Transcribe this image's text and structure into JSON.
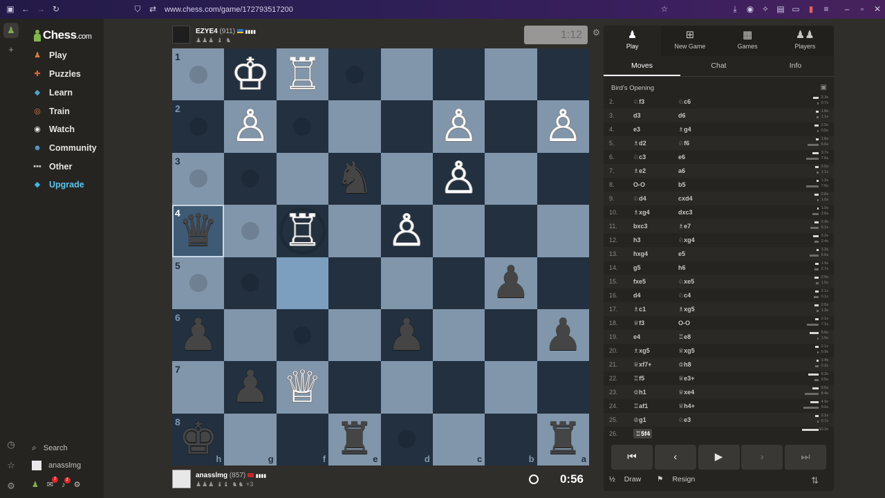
{
  "browser": {
    "url": "www.chess.com/game/172793517200"
  },
  "nav": {
    "logo": "Chess",
    "logo_suffix": ".com",
    "items": [
      {
        "label": "Play",
        "icon": "play-icon",
        "color": "#e07b3a"
      },
      {
        "label": "Puzzles",
        "icon": "puzzle-icon",
        "color": "#e0633a"
      },
      {
        "label": "Learn",
        "icon": "learn-icon",
        "color": "#4ba5c9"
      },
      {
        "label": "Train",
        "icon": "train-icon",
        "color": "#e07b3a"
      },
      {
        "label": "Watch",
        "icon": "watch-icon",
        "color": "#e6e5e3"
      },
      {
        "label": "Community",
        "icon": "community-icon",
        "color": "#5b9fd6"
      },
      {
        "label": "Other",
        "icon": "more-icon",
        "color": "#c3c2c0"
      },
      {
        "label": "Upgrade",
        "icon": "diamond-icon",
        "color": "#3fb9e6"
      }
    ],
    "search_label": "Search",
    "username": "anasslmg",
    "mail_badge": "7",
    "notif_badge": "2"
  },
  "top_player": {
    "name": "EZYE4",
    "rating": "(911)",
    "clock": "1:12"
  },
  "bottom_player": {
    "name": "anasslmg",
    "rating": "(857)",
    "captured_extra": "+3",
    "clock": "0:56"
  },
  "board": {
    "ranks": [
      "1",
      "2",
      "3",
      "4",
      "5",
      "6",
      "7",
      "8"
    ],
    "files": [
      "h",
      "g",
      "f",
      "e",
      "d",
      "c",
      "b",
      "a"
    ],
    "rows": [
      [
        {
          "c": "l",
          "dot": 1
        },
        {
          "c": "d",
          "p": "♔",
          "s": "w"
        },
        {
          "c": "l",
          "p": "♖",
          "s": "w"
        },
        {
          "c": "d",
          "dot": 1
        },
        {
          "c": "l"
        },
        {
          "c": "d"
        },
        {
          "c": "l"
        },
        {
          "c": "d"
        }
      ],
      [
        {
          "c": "d",
          "dot": 1
        },
        {
          "c": "l",
          "p": "♙",
          "s": "w"
        },
        {
          "c": "d",
          "dot": 1
        },
        {
          "c": "l"
        },
        {
          "c": "d"
        },
        {
          "c": "l",
          "p": "♙",
          "s": "w"
        },
        {
          "c": "d"
        },
        {
          "c": "l",
          "p": "♙",
          "s": "w"
        }
      ],
      [
        {
          "c": "l",
          "dot": 1
        },
        {
          "c": "d",
          "dot": 1
        },
        {
          "c": "l"
        },
        {
          "c": "d",
          "p": "♞",
          "s": "b"
        },
        {
          "c": "l"
        },
        {
          "c": "d",
          "p": "♙",
          "s": "w"
        },
        {
          "c": "l"
        },
        {
          "c": "d"
        }
      ],
      [
        {
          "c": "sel",
          "p": "♛",
          "s": "b"
        },
        {
          "c": "l",
          "dot": 1
        },
        {
          "c": "d",
          "p": "♖",
          "s": "w",
          "ring": 1
        },
        {
          "c": "l"
        },
        {
          "c": "d",
          "p": "♙",
          "s": "w"
        },
        {
          "c": "l"
        },
        {
          "c": "d"
        },
        {
          "c": "l"
        }
      ],
      [
        {
          "c": "l",
          "dot": 1
        },
        {
          "c": "d",
          "dot": 1
        },
        {
          "c": "hl"
        },
        {
          "c": "d"
        },
        {
          "c": "l"
        },
        {
          "c": "d"
        },
        {
          "c": "l",
          "p": "♟",
          "s": "b"
        },
        {
          "c": "d"
        }
      ],
      [
        {
          "c": "d",
          "p": "♟",
          "s": "b"
        },
        {
          "c": "l"
        },
        {
          "c": "d",
          "dot": 1
        },
        {
          "c": "l"
        },
        {
          "c": "d",
          "p": "♟",
          "s": "b"
        },
        {
          "c": "l"
        },
        {
          "c": "d"
        },
        {
          "c": "l",
          "p": "♟",
          "s": "b"
        }
      ],
      [
        {
          "c": "l"
        },
        {
          "c": "d",
          "p": "♟",
          "s": "b"
        },
        {
          "c": "l",
          "p": "♕",
          "s": "w"
        },
        {
          "c": "d"
        },
        {
          "c": "l"
        },
        {
          "c": "d"
        },
        {
          "c": "l"
        },
        {
          "c": "d"
        }
      ],
      [
        {
          "c": "d",
          "p": "♚",
          "s": "b"
        },
        {
          "c": "l"
        },
        {
          "c": "d"
        },
        {
          "c": "l",
          "p": "♜",
          "s": "b"
        },
        {
          "c": "d",
          "dot": 1
        },
        {
          "c": "l"
        },
        {
          "c": "d"
        },
        {
          "c": "l",
          "p": "♜",
          "s": "b"
        }
      ]
    ]
  },
  "panel": {
    "tabs": [
      {
        "label": "Play",
        "icon": "pawn-play-icon"
      },
      {
        "label": "New Game",
        "icon": "plus-icon"
      },
      {
        "label": "Games",
        "icon": "board-icon"
      },
      {
        "label": "Players",
        "icon": "players-icon"
      }
    ],
    "subtabs": [
      "Moves",
      "Chat",
      "Info"
    ],
    "opening": "Bird's Opening",
    "moves": [
      {
        "n": "2.",
        "w": "♘f3",
        "b": "♘c6",
        "wt": "3.3s",
        "bt": "0.7s",
        "wf": 0.32,
        "bf": 0.07
      },
      {
        "n": "3.",
        "w": "d3",
        "b": "d6",
        "wt": "1.8s",
        "bt": "1.1s",
        "wf": 0.18,
        "bf": 0.11
      },
      {
        "n": "4.",
        "w": "e3",
        "b": "♗g4",
        "wt": "2.5s",
        "bt": "0.5s",
        "wf": 0.25,
        "bf": 0.05
      },
      {
        "n": "5.",
        "w": "♗d2",
        "b": "♘f6",
        "wt": "1.6s",
        "bt": "6.6s",
        "wf": 0.16,
        "bf": 0.66
      },
      {
        "n": "6.",
        "w": "♘c3",
        "b": "e6",
        "wt": "3.7s",
        "bt": "7.6s",
        "wf": 0.37,
        "bf": 0.76
      },
      {
        "n": "7.",
        "w": "♗e2",
        "b": "a6",
        "wt": "2.0s",
        "bt": "1.1s",
        "wf": 0.2,
        "bf": 0.11
      },
      {
        "n": "8.",
        "w": "O-O",
        "b": "b5",
        "wt": "1.2s",
        "bt": "7.6s",
        "wf": 0.12,
        "bf": 0.76
      },
      {
        "n": "9.",
        "w": "♘d4",
        "b": "cxd4",
        "wt": "2.6s",
        "bt": "1.0s",
        "wf": 0.26,
        "bf": 0.1
      },
      {
        "n": "10.",
        "w": "♗xg4",
        "b": "dxc3",
        "wt": "1.0s",
        "bt": "3.6s",
        "wf": 0.1,
        "bf": 0.36
      },
      {
        "n": "11.",
        "w": "bxc3",
        "b": "♗e7",
        "wt": "2.4s",
        "bt": "5.1s",
        "wf": 0.24,
        "bf": 0.51
      },
      {
        "n": "12.",
        "w": "h3",
        "b": "♘xg4",
        "wt": "3.2s",
        "bt": "2.4s",
        "wf": 0.32,
        "bf": 0.24
      },
      {
        "n": "13.",
        "w": "hxg4",
        "b": "e5",
        "wt": "1.2s",
        "bt": "5.6s",
        "wf": 0.12,
        "bf": 0.56
      },
      {
        "n": "14.",
        "w": "g5",
        "b": "h6",
        "wt": "1.9s",
        "bt": "2.7s",
        "wf": 0.19,
        "bf": 0.27
      },
      {
        "n": "15.",
        "w": "fxe5",
        "b": "♘xe5",
        "wt": "2.5s",
        "bt": "1.5s",
        "wf": 0.25,
        "bf": 0.15
      },
      {
        "n": "16.",
        "w": "d4",
        "b": "♘c4",
        "wt": "2.1s",
        "bt": "3.1s",
        "wf": 0.21,
        "bf": 0.31
      },
      {
        "n": "17.",
        "w": "♗c1",
        "b": "♗xg5",
        "wt": "2.5s",
        "bt": "1.3s",
        "wf": 0.25,
        "bf": 0.13
      },
      {
        "n": "18.",
        "w": "♕f3",
        "b": "O-O",
        "wt": "2.1s",
        "bt": "7.1s",
        "wf": 0.21,
        "bf": 0.71
      },
      {
        "n": "19.",
        "w": "e4",
        "b": "♖e8",
        "wt": "5.6s",
        "bt": "1.0s",
        "wf": 0.56,
        "bf": 0.1
      },
      {
        "n": "20.",
        "w": "♗xg5",
        "b": "♕xg5",
        "wt": "2.1s",
        "bt": "0.9s",
        "wf": 0.21,
        "bf": 0.09
      },
      {
        "n": "21.",
        "w": "♕xf7+",
        "b": "♔h8",
        "wt": "1.4s",
        "bt": "2.2s",
        "wf": 0.14,
        "bf": 0.22
      },
      {
        "n": "22.",
        "w": "♖f5",
        "b": "♕e3+",
        "wt": "6.3s",
        "bt": "2.5s",
        "wf": 0.63,
        "bf": 0.25
      },
      {
        "n": "23.",
        "w": "♔h1",
        "b": "♕xe4",
        "wt": "3.6s",
        "bt": "8.4s",
        "wf": 0.36,
        "bf": 0.84
      },
      {
        "n": "24.",
        "w": "♖af1",
        "b": "♕h4+",
        "wt": "4.9s",
        "bt": "9.0s",
        "wf": 0.49,
        "bf": 0.9
      },
      {
        "n": "25.",
        "w": "♔g1",
        "b": "♘e3",
        "wt": "2.1s",
        "bt": "0.7s",
        "wf": 0.21,
        "bf": 0.07
      },
      {
        "n": "26.",
        "w": "♖5f4",
        "b": "",
        "wt": "10.2s",
        "bt": "",
        "wf": 1.0,
        "bf": 0
      }
    ],
    "draw_label": "Draw",
    "draw_prefix": "½",
    "resign_label": "Resign"
  }
}
